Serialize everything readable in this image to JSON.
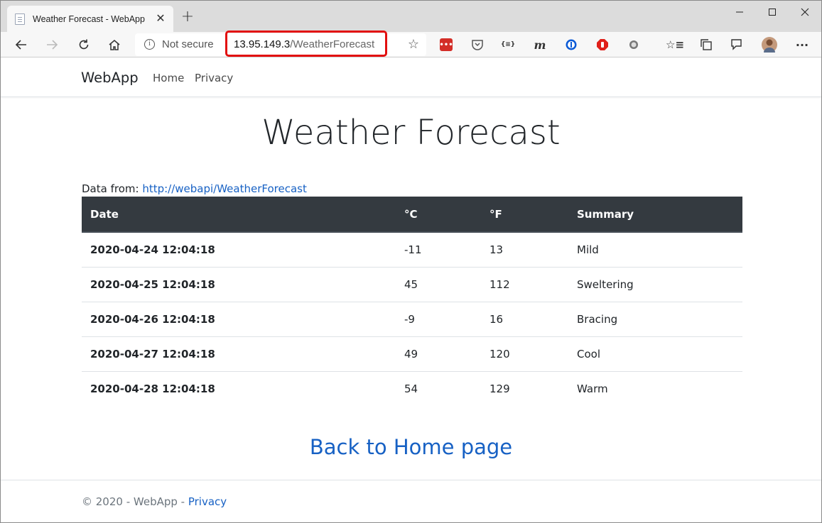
{
  "browser": {
    "tab_title": "Weather Forecast - WebApp",
    "security_label": "Not secure",
    "url_host": "13.95.149.3",
    "url_path": "/WeatherForecast",
    "highlight_color": "#e20f0f"
  },
  "navbar": {
    "brand": "WebApp",
    "links": [
      "Home",
      "Privacy"
    ]
  },
  "main": {
    "title": "Weather Forecast",
    "data_from_label": "Data from:",
    "data_from_link": "http://webapi/WeatherForecast",
    "table": {
      "headers": [
        "Date",
        "°C",
        "°F",
        "Summary"
      ],
      "rows": [
        [
          "2020-04-24 12:04:18",
          "-11",
          "13",
          "Mild"
        ],
        [
          "2020-04-25 12:04:18",
          "45",
          "112",
          "Sweltering"
        ],
        [
          "2020-04-26 12:04:18",
          "-9",
          "16",
          "Bracing"
        ],
        [
          "2020-04-27 12:04:18",
          "49",
          "120",
          "Cool"
        ],
        [
          "2020-04-28 12:04:18",
          "54",
          "129",
          "Warm"
        ]
      ]
    },
    "back_link": "Back to Home page"
  },
  "footer": {
    "text": "© 2020 - WebApp -",
    "privacy_link": "Privacy"
  },
  "colors": {
    "link": "#1761c4",
    "table_header_bg": "#343a40"
  },
  "icons": [
    "back-icon",
    "forward-icon",
    "refresh-icon",
    "home-icon",
    "info-icon",
    "star-icon",
    "lastpass-icon",
    "pocket-icon",
    "json-icon",
    "mendeley-icon",
    "onepassword-icon",
    "adblock-icon",
    "extension-icon",
    "favorites-icon",
    "collections-icon",
    "feedback-icon",
    "avatar",
    "more-icon"
  ]
}
